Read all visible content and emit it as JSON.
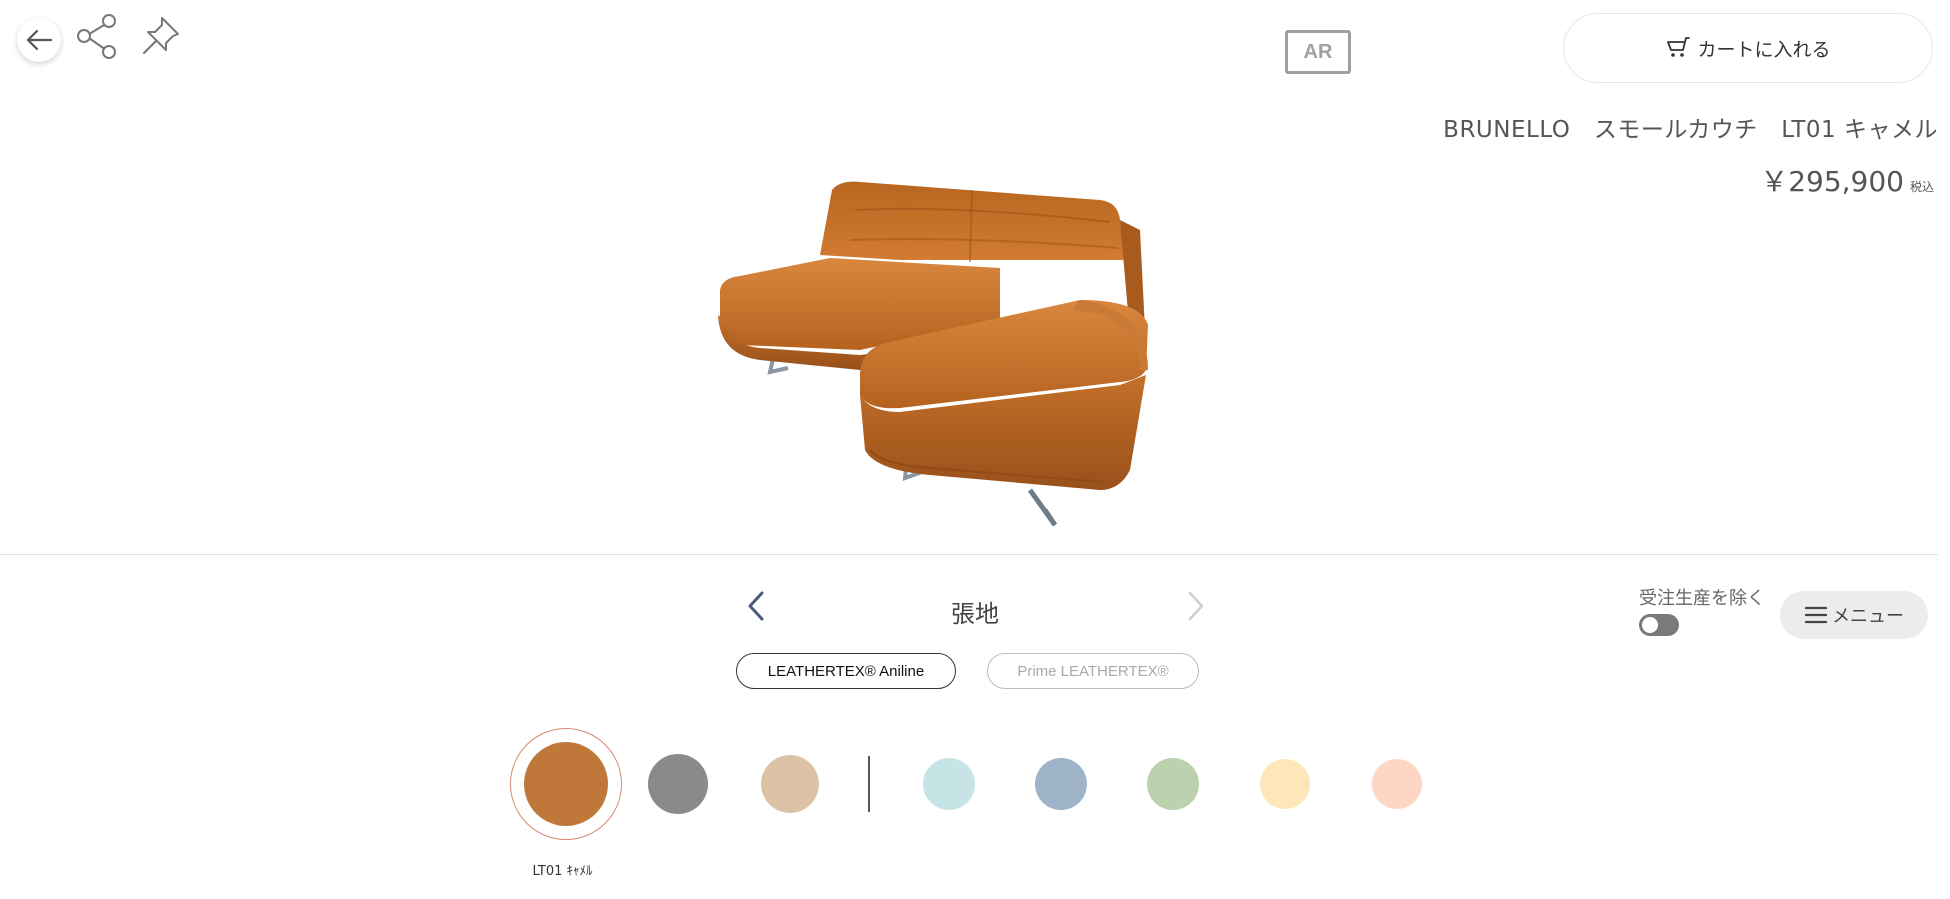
{
  "header": {
    "ar_label": "AR",
    "cart_label": "カートに入れる"
  },
  "product": {
    "name": "BRUNELLO　スモールカウチ　LT01 キャメル",
    "price": "￥295,900",
    "tax_label": "税込"
  },
  "selector": {
    "category_title": "張地",
    "material_tabs": [
      {
        "label": "LEATHERTEX® Aniline",
        "selected": true
      },
      {
        "label": "Prime LEATHERTEX®",
        "selected": false
      }
    ],
    "exclude_made_to_order_label": "受注生産を除く",
    "exclude_toggle_on": false,
    "menu_label": "メニュー"
  },
  "swatches": {
    "selected_label": "LT01 ｷｬﾒﾙ",
    "colors": [
      "#c0783a",
      "#8a8a8a",
      "#dcc3a6",
      "#c6e4e6",
      "#9fb4c8",
      "#bcd2ae",
      "#fde6b8",
      "#fdd7c4"
    ]
  },
  "colors": {
    "leather": "#c26d2a",
    "accent_ring": "#d98a72",
    "arrow_active": "#4a5a7a",
    "arrow_disabled": "#cfcfcf"
  }
}
